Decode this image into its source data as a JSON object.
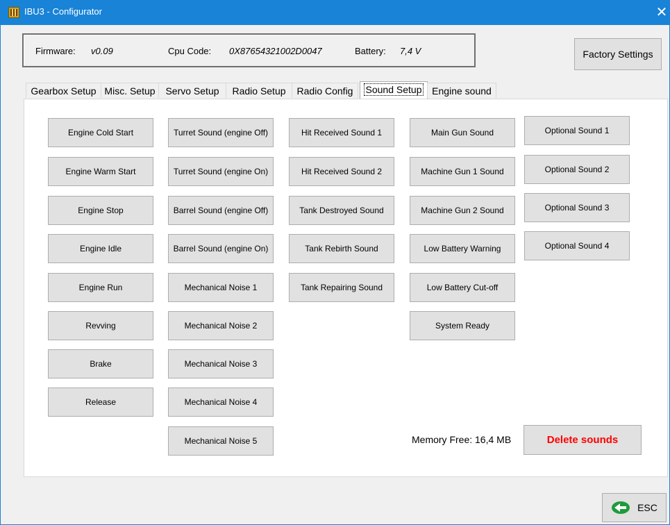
{
  "window": {
    "title": "IBU3 - Configurator",
    "close_label": "✕"
  },
  "info": {
    "firmware_label": "Firmware:",
    "firmware_value": "v0.09",
    "cpu_label": "Cpu Code:",
    "cpu_value": "0X87654321002D0047",
    "battery_label": "Battery:",
    "battery_value": "7,4 V"
  },
  "factory_settings_label": "Factory Settings",
  "tabs": [
    {
      "label": "Gearbox Setup"
    },
    {
      "label": "Misc. Setup"
    },
    {
      "label": "Servo Setup"
    },
    {
      "label": "Radio Setup"
    },
    {
      "label": "Radio Config"
    },
    {
      "label": "Sound Setup",
      "active": true
    },
    {
      "label": "Engine sound"
    }
  ],
  "sound_columns": {
    "engine": [
      "Engine Cold Start",
      "Engine Warm Start",
      "Engine Stop",
      "Engine Idle",
      "Engine Run",
      "Revving",
      "Brake",
      "Release"
    ],
    "turret": [
      "Turret Sound (engine Off)",
      "Turret Sound (engine On)",
      "Barrel Sound (engine Off)",
      "Barrel Sound (engine On)",
      "Mechanical Noise 1",
      "Mechanical Noise 2",
      "Mechanical Noise 3",
      "Mechanical Noise 4",
      "Mechanical Noise 5"
    ],
    "hit": [
      "Hit Received Sound 1",
      "Hit Received Sound 2",
      "Tank Destroyed Sound",
      "Tank Rebirth Sound",
      "Tank Repairing Sound"
    ],
    "gun": [
      "Main Gun Sound",
      "Machine Gun 1 Sound",
      "Machine Gun 2 Sound",
      "Low Battery Warning",
      "Low Battery Cut-off",
      "System Ready"
    ],
    "optional": [
      "Optional Sound 1",
      "Optional Sound 2",
      "Optional Sound 3",
      "Optional Sound 4"
    ]
  },
  "memory_label": "Memory Free:  16,4 MB",
  "delete_label": "Delete sounds",
  "esc_label": "ESC",
  "colors": {
    "titlebar": "#1883d7",
    "delete_text": "#ff0000",
    "esc_arrow": "#1e9b3a"
  },
  "icons": {
    "app": "app-chip-icon",
    "esc": "back-arrow-icon"
  }
}
